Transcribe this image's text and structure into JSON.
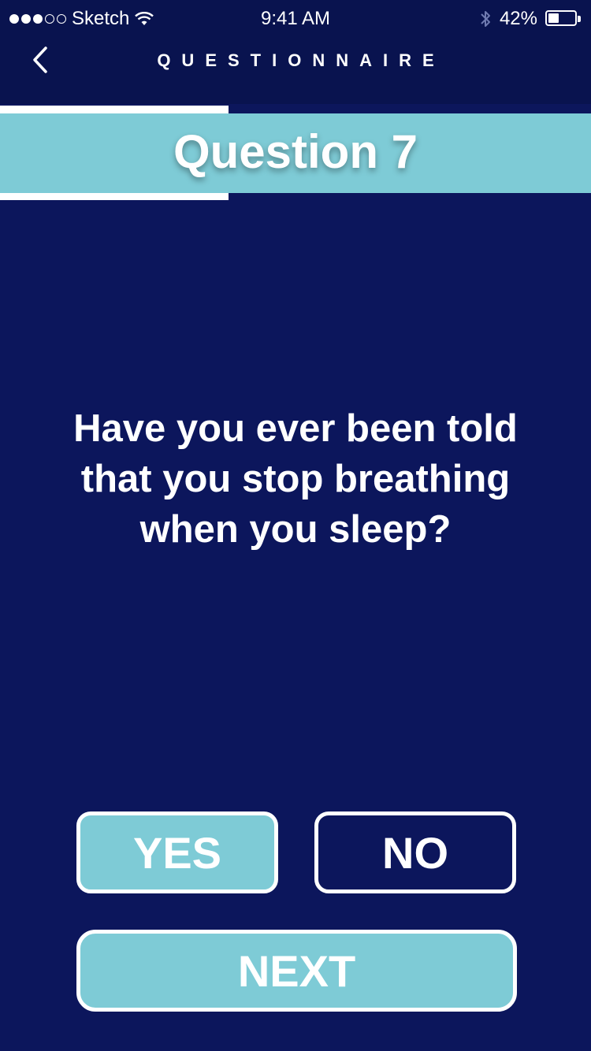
{
  "status_bar": {
    "carrier": "Sketch",
    "time": "9:41 AM",
    "battery": "42%",
    "battery_level": 0.42,
    "signal_bars_filled": 3,
    "signal_bars_total": 5
  },
  "nav": {
    "title": "QUESTIONNAIRE",
    "back_icon": "chevron-left-icon"
  },
  "question": {
    "number_label": "Question 7",
    "text": "Have you ever been told that you stop breathing when you sleep?"
  },
  "answers": {
    "yes_label": "YES",
    "no_label": "NO",
    "selected": "YES"
  },
  "footer": {
    "next_label": "NEXT"
  },
  "colors": {
    "background": "#0c165c",
    "header": "#09134f",
    "accent": "#7ecbd6",
    "text": "#ffffff"
  }
}
